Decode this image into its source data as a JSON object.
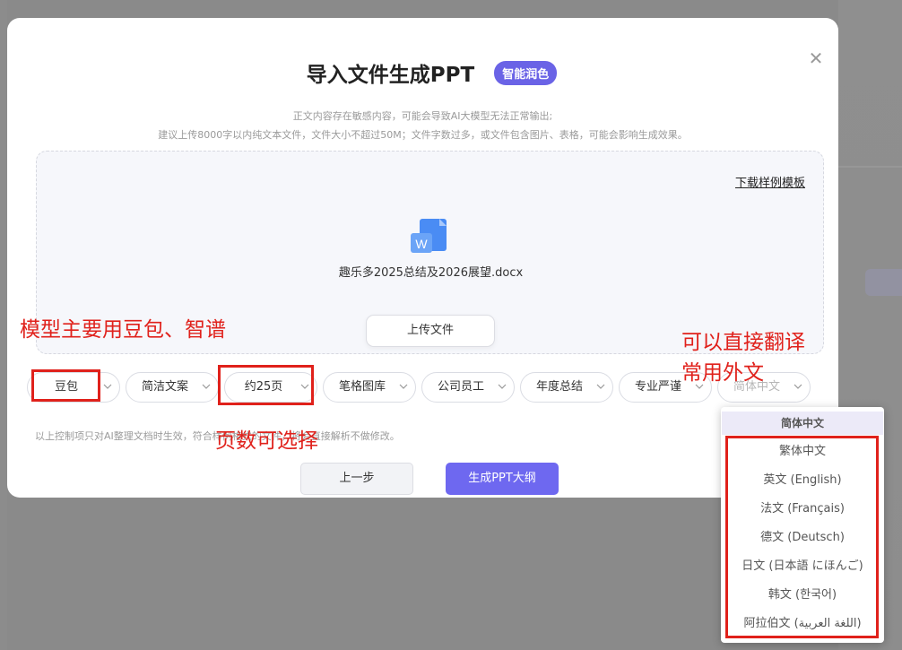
{
  "dialog": {
    "title": "导入文件生成PPT",
    "badge": "智能润色",
    "notice_line1": "正文内容存在敏感内容，可能会导致AI大模型无法正常输出;",
    "notice_line2": "建议上传8000字以内纯文本文件，文件大小不超过50M；文件字数过多，或文件包含图片、表格，可能会影响生成效果。",
    "close_icon": "close-icon"
  },
  "upload": {
    "download_template": "下载样例模板",
    "file_icon": "word-document-icon",
    "file_icon_letter": "W",
    "file_name": "趣乐多2025总结及2026展望.docx",
    "upload_button": "上传文件"
  },
  "options": [
    {
      "label": "豆包"
    },
    {
      "label": "简洁文案"
    },
    {
      "label": "约25页"
    },
    {
      "label": "笔格图库"
    },
    {
      "label": "公司员工"
    },
    {
      "label": "年度总结"
    },
    {
      "label": "专业严谨"
    },
    {
      "label": "简体中文"
    }
  ],
  "hint": "以上控制项只对AI整理文档时生效，符合样例格式的文件，将会直接解析不做修改。",
  "buttons": {
    "prev": "上一步",
    "generate": "生成PPT大纲"
  },
  "language_dropdown": {
    "selected": "简体中文",
    "items": [
      "繁体中文",
      "英文 (English)",
      "法文 (Français)",
      "德文 (Deutsch)",
      "日文 (日本語 にほんご)",
      "韩文 (한국어)",
      "阿拉伯文 (اللغة العربية)"
    ]
  },
  "annotations": {
    "model": "模型主要用豆包、智谱",
    "pages": "页数可选择",
    "translate_line1": "可以直接翻译",
    "translate_line2": "常用外文"
  },
  "colors": {
    "accent": "#6e68f0",
    "badge": "#6a63e6",
    "annotation": "#e0211b",
    "overlay": "#8a8a8a"
  }
}
